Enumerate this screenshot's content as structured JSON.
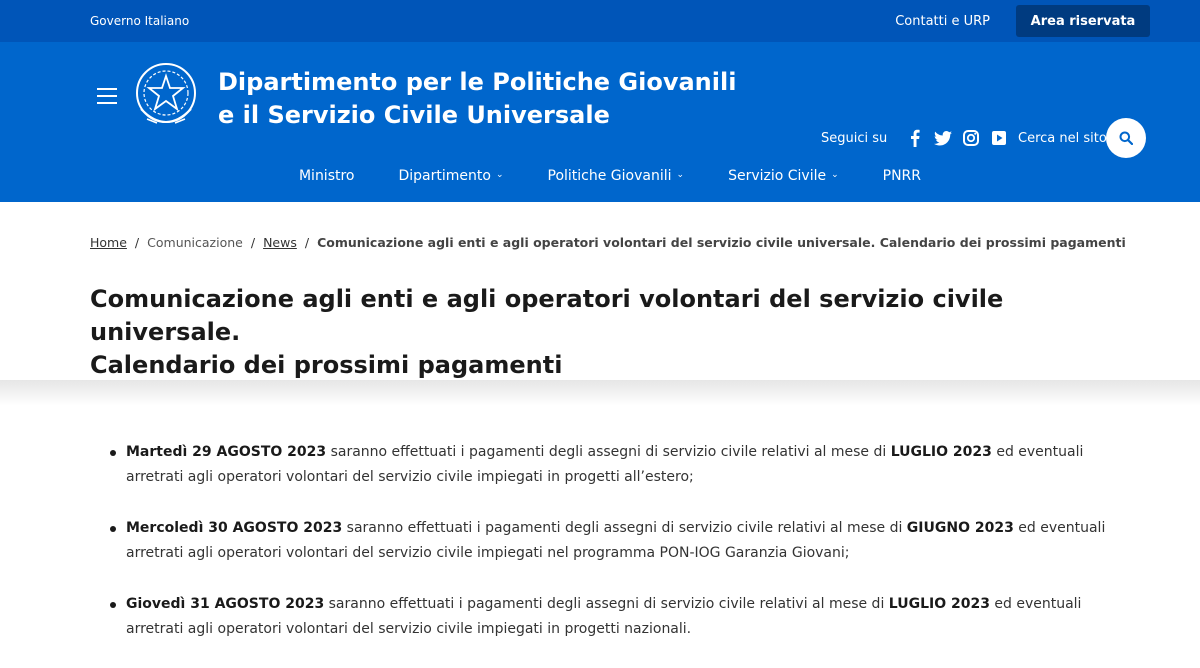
{
  "slim_header": {
    "gov_label": "Governo Italiano",
    "contacts_label": "Contatti e URP",
    "reserved_area_label": "Area riservata"
  },
  "header": {
    "brand_line1": "Dipartimento per le Politiche Giovanili",
    "brand_line2": "e il Servizio Civile Universale",
    "follow_label": "Seguici su",
    "social_icons": [
      "facebook-icon",
      "twitter-icon",
      "instagram-icon",
      "youtube-icon"
    ],
    "search_label": "Cerca nel sito",
    "colors": {
      "slim_bg": "#0055b8",
      "header_bg": "#0066cc",
      "reserved_bg": "#003b80"
    }
  },
  "nav": {
    "items": [
      {
        "label": "Ministro",
        "dropdown": false
      },
      {
        "label": "Dipartimento",
        "dropdown": true
      },
      {
        "label": "Politiche Giovanili",
        "dropdown": true
      },
      {
        "label": "Servizio Civile",
        "dropdown": true
      },
      {
        "label": "PNRR",
        "dropdown": false
      }
    ]
  },
  "breadcrumb": {
    "home": "Home",
    "section": "Comunicazione",
    "news": "News",
    "current": "Comunicazione agli enti e agli operatori volontari del servizio civile universale. Calendario dei prossimi pagamenti",
    "separator": "/"
  },
  "page": {
    "title_line1": "Comunicazione agli enti e agli operatori volontari del servizio civile universale.",
    "title_line2": "Calendario dei prossimi pagamenti"
  },
  "content": {
    "items": [
      {
        "date": "Martedì 29 AGOSTO 2023",
        "text1": " saranno effettuati i pagamenti degli assegni di servizio civile relativi al mese di ",
        "month": "LUGLIO 2023",
        "text2": " ed eventuali arretrati agli operatori volontari del servizio civile impiegati in progetti all’estero;"
      },
      {
        "date": "Mercoledì 30 AGOSTO 2023",
        "text1": " saranno effettuati i pagamenti degli assegni di servizio civile relativi al mese di ",
        "month": "GIUGNO 2023",
        "text2": " ed eventuali arretrati agli operatori volontari del servizio civile impiegati nel programma PON-IOG Garanzia Giovani;"
      },
      {
        "date": "Giovedì 31 AGOSTO 2023",
        "text1": " saranno effettuati i pagamenti degli assegni di servizio civile relativi al mese di ",
        "month": "LUGLIO 2023",
        "text2": " ed eventuali arretrati agli operatori volontari del servizio civile impiegati in progetti nazionali."
      }
    ]
  }
}
